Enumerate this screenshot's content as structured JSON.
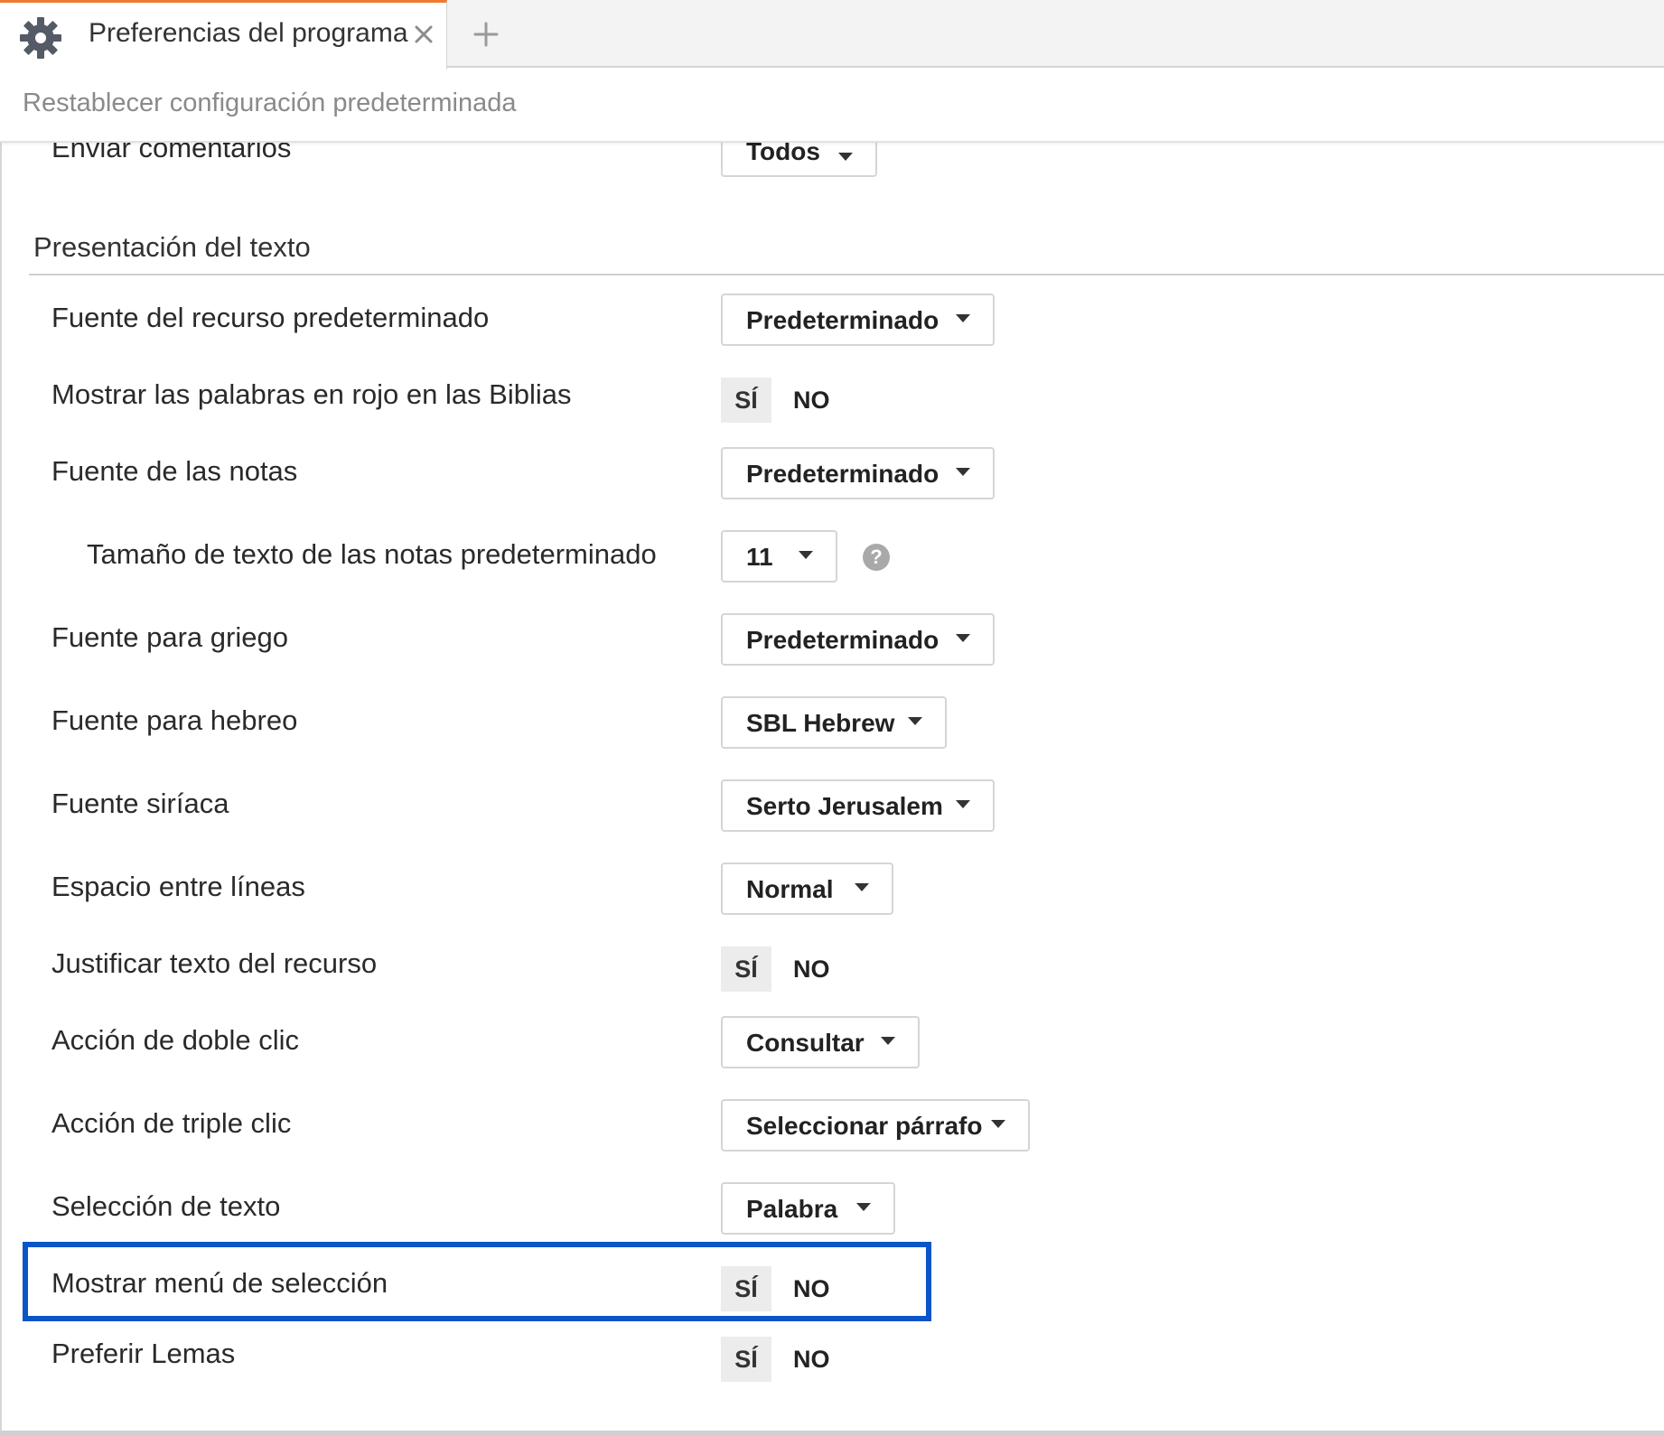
{
  "tab": {
    "title": "Preferencias del programa",
    "icon": "gear-icon",
    "accent_color": "#f07a2b"
  },
  "toolbar": {
    "reset_label": "Restablecer configuración predeterminada"
  },
  "top_row": {
    "label": "Enviar comentarios",
    "value": "Todos"
  },
  "section": {
    "title": "Presentación del texto"
  },
  "rows": [
    {
      "label": "Fuente del recurso predeterminado",
      "type": "dropdown",
      "value": "Predeterminado"
    },
    {
      "label": "Mostrar las palabras en rojo en las Biblias",
      "type": "toggle",
      "yes": "SÍ",
      "no": "NO",
      "selected": "SÍ"
    },
    {
      "label": "Fuente de las notas",
      "type": "dropdown",
      "value": "Predeterminado"
    },
    {
      "label": "Tamaño de texto de las notas predeterminado",
      "type": "dropdown",
      "value": "11",
      "indented": true,
      "help_icon": "question-icon"
    },
    {
      "label": "Fuente para griego",
      "type": "dropdown",
      "value": "Predeterminado"
    },
    {
      "label": "Fuente para hebreo",
      "type": "dropdown",
      "value": "SBL Hebrew"
    },
    {
      "label": "Fuente siríaca",
      "type": "dropdown",
      "value": "Serto Jerusalem"
    },
    {
      "label": "Espacio entre líneas",
      "type": "dropdown",
      "value": "Normal"
    },
    {
      "label": "Justificar texto del recurso",
      "type": "toggle",
      "yes": "SÍ",
      "no": "NO",
      "selected": "SÍ"
    },
    {
      "label": "Acción de doble clic",
      "type": "dropdown",
      "value": "Consultar"
    },
    {
      "label": "Acción de triple clic",
      "type": "dropdown",
      "value": "Seleccionar párrafo"
    },
    {
      "label": "Selección de texto",
      "type": "dropdown",
      "value": "Palabra"
    },
    {
      "label": "Mostrar menú de selección",
      "type": "toggle",
      "yes": "SÍ",
      "no": "NO",
      "selected": "SÍ",
      "highlighted": true
    },
    {
      "label": "Preferir Lemas",
      "type": "toggle",
      "yes": "SÍ",
      "no": "NO",
      "selected": "SÍ"
    }
  ],
  "help": {
    "glyph": "?"
  },
  "highlight_color": "#0b55c8"
}
